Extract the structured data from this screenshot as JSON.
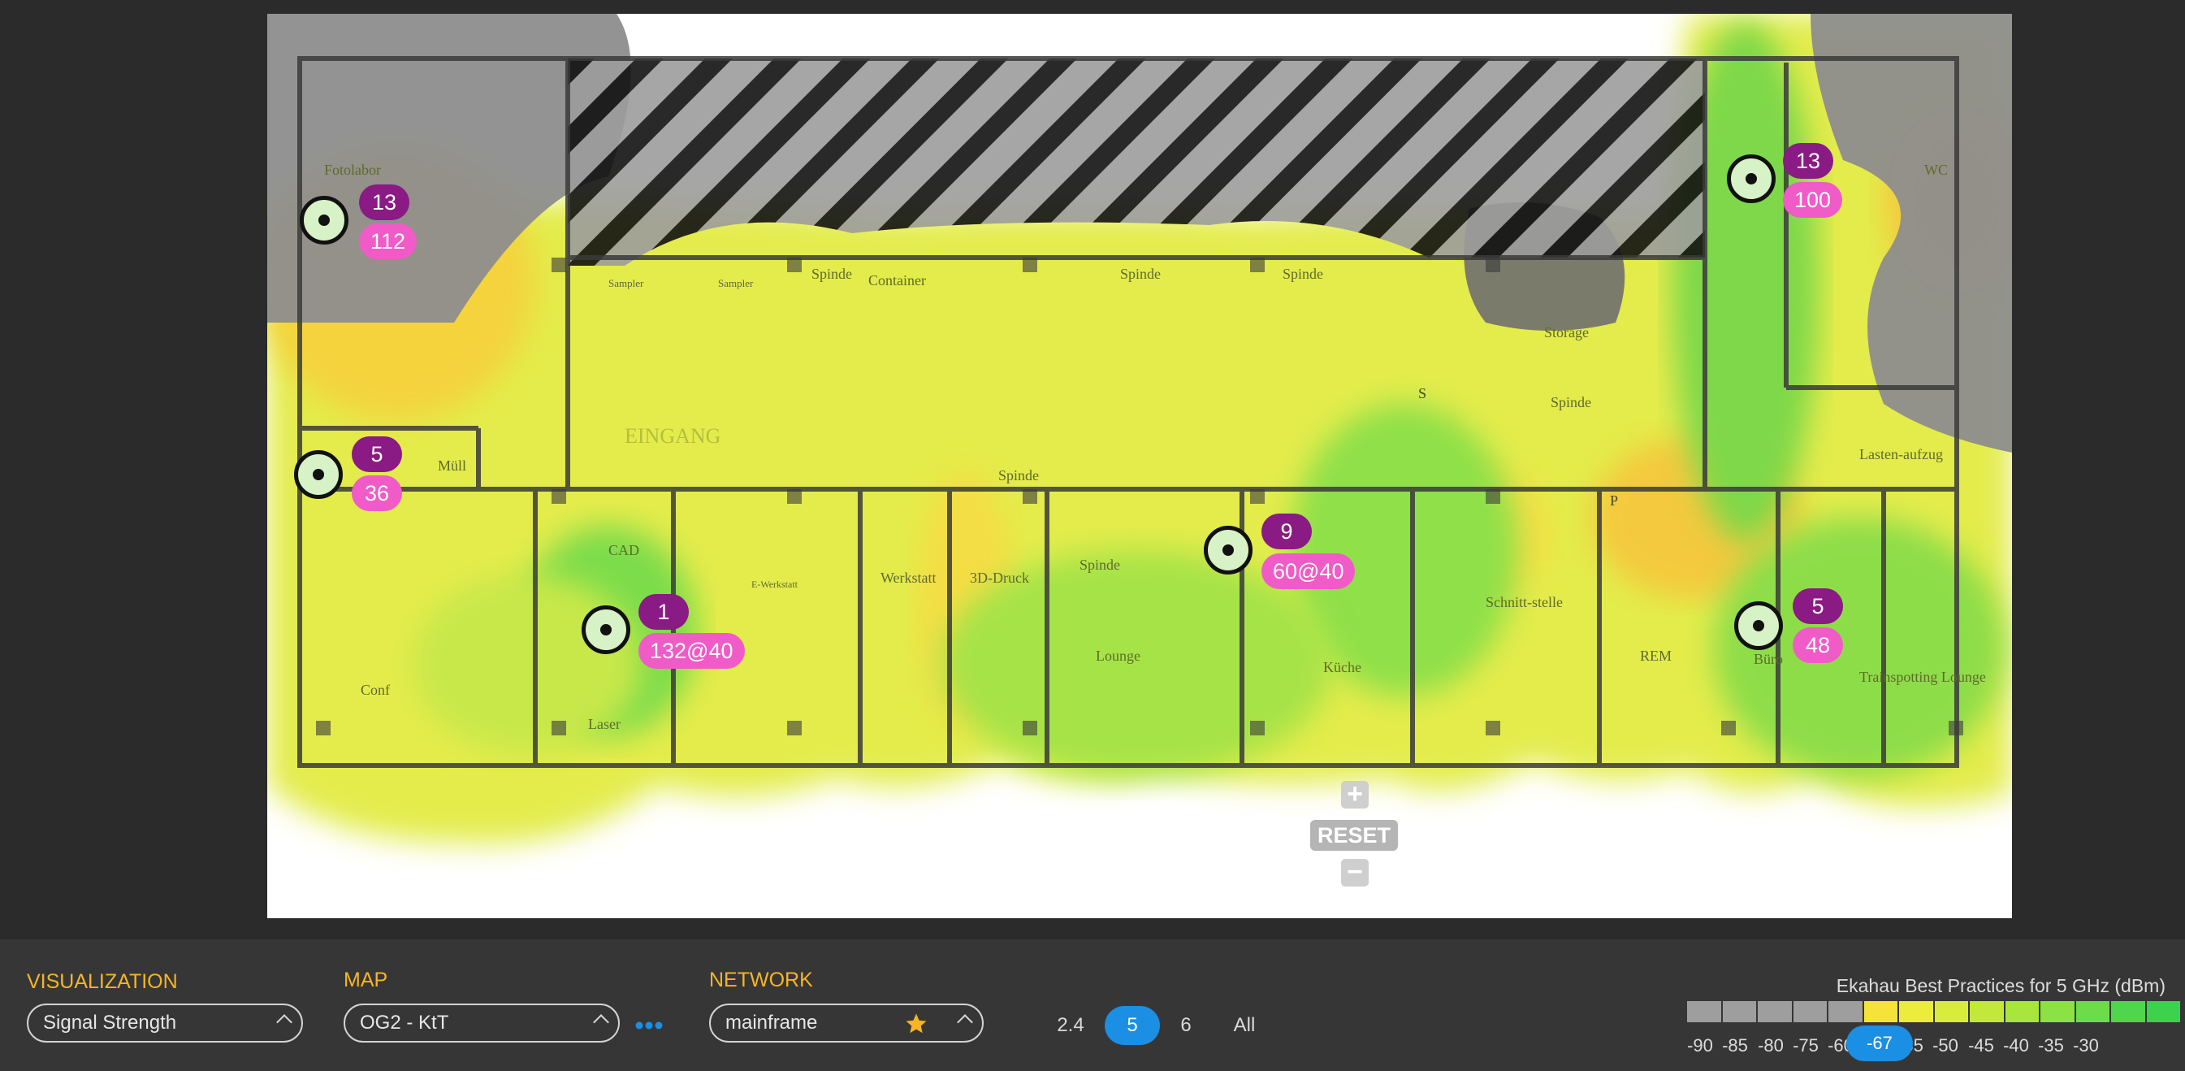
{
  "map": {
    "room_labels": [
      "Fotolabor",
      "Müll",
      "CAD",
      "Laser",
      "Conf",
      "Werkstatt",
      "3D-Druck",
      "Lounge",
      "Küche",
      "Schnitt-stelle",
      "REM",
      "Büro",
      "Trainspotting Lounge",
      "Storage",
      "WC",
      "Lasten-aufzug",
      "Container",
      "Spinde",
      "Spinde",
      "Spinde",
      "Spinde",
      "Spinde",
      "Spinde",
      "Sampler",
      "Sampler",
      "EINGANG",
      "E-Werkstatt",
      "S",
      "P"
    ],
    "access_points": [
      {
        "channel": "13",
        "width": "112"
      },
      {
        "channel": "5",
        "width": "36"
      },
      {
        "channel": "1",
        "width": "132@40"
      },
      {
        "channel": "9",
        "width": "60@40"
      },
      {
        "channel": "13",
        "width": "100"
      },
      {
        "channel": "5",
        "width": "48"
      }
    ],
    "zoom_in_icon": "plus-icon",
    "reset_label": "RESET",
    "zoom_out_icon": "minus-icon"
  },
  "toolbar": {
    "visualization": {
      "label": "VISUALIZATION",
      "value": "Signal Strength"
    },
    "map": {
      "label": "MAP",
      "value": "OG2 - KtT",
      "more_icon": "more-dots-icon"
    },
    "network": {
      "label": "NETWORK",
      "value": "mainframe",
      "favorite_icon": "star-icon"
    },
    "bands": [
      "2.4",
      "5",
      "6",
      "All"
    ],
    "active_band": "5"
  },
  "legend": {
    "title": "Ekahau Best Practices for 5 GHz (dBm)",
    "ticks": [
      "-90",
      "-85",
      "-80",
      "-75",
      "-60",
      "-55",
      "-50",
      "-45",
      "-40",
      "-35",
      "-30"
    ],
    "threshold": "-67",
    "cell_colors": [
      "#9e9e9e",
      "#9e9e9e",
      "#9e9e9e",
      "#9e9e9e",
      "#9e9e9e",
      "#f6e33a",
      "#ecec3a",
      "#d8ec3a",
      "#c2e83a",
      "#a8e63e",
      "#8ce244",
      "#6edc4a",
      "#4fd64e",
      "#3cd24f"
    ]
  },
  "colors": {
    "accent": "#f6b526",
    "selected": "#1a8fe3",
    "channel_badge": "#8a1a84",
    "width_badge": "#f05bc8"
  }
}
